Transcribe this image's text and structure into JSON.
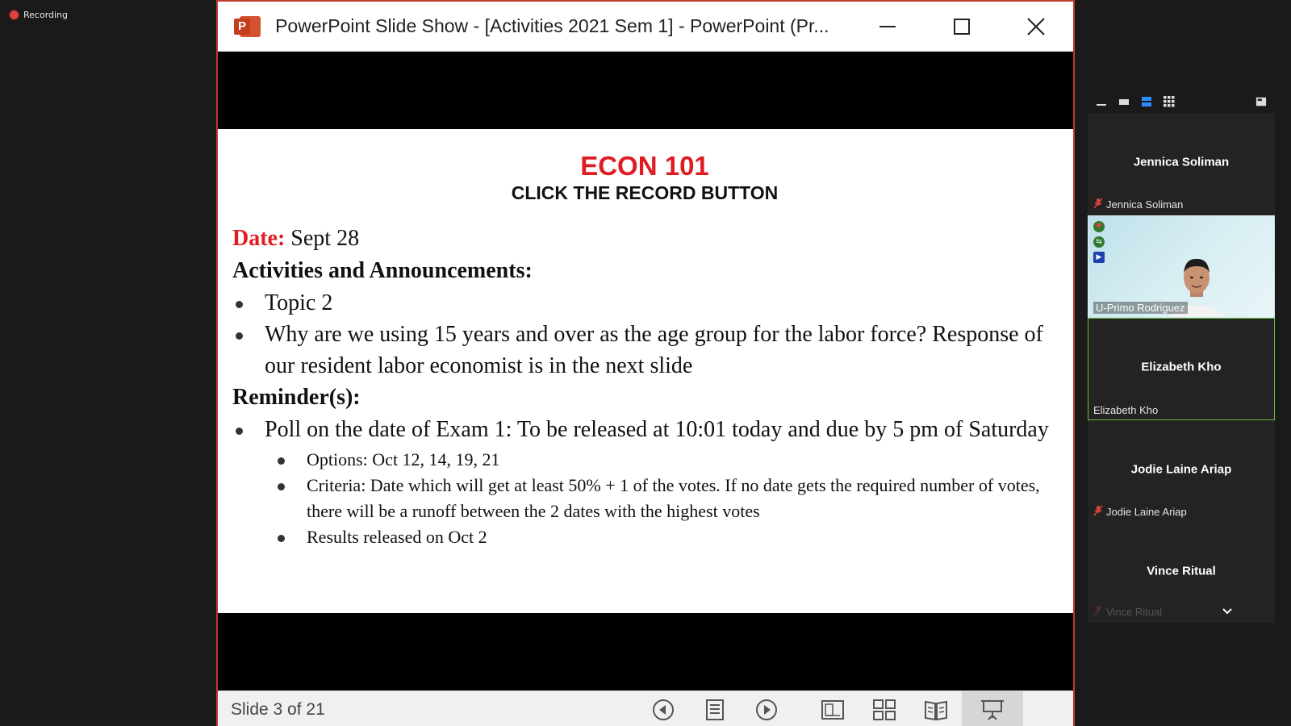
{
  "recording": {
    "label": "Recording"
  },
  "window": {
    "title": "PowerPoint Slide Show - [Activities 2021 Sem 1] - PowerPoint (Pr...",
    "app_icon": "powerpoint-icon",
    "controls": [
      "minimize-icon",
      "maximize-icon",
      "close-icon"
    ]
  },
  "slide": {
    "title": "ECON 101",
    "subtitle": "CLICK THE RECORD BUTTON",
    "date_label": "Date:",
    "date_value": "Sept 28",
    "activities_heading": "Activities and Announcements:",
    "activities": [
      "Topic 2",
      "Why are we using 15 years and over as the age group for the labor force? Response of our resident labor economist is in the next slide"
    ],
    "reminders_heading": "Reminder(s):",
    "reminders": [
      "Poll on the date of Exam 1: To be released at 10:01 today and due by 5 pm of Saturday"
    ],
    "sub_reminders": [
      "Options: Oct 12, 14, 19, 21",
      "Criteria: Date which will get at least 50% + 1 of the votes. If no date gets the required number of votes, there will be a runoff between the 2 dates with the highest votes",
      "Results released on Oct 2"
    ]
  },
  "statusbar": {
    "counter": "Slide 3 of 21",
    "icons": [
      "previous-icon",
      "notes-icon",
      "next-icon",
      "normal-view-icon",
      "slide-sorter-icon",
      "reading-view-icon",
      "slideshow-icon"
    ]
  },
  "participants": [
    {
      "name": "Jennica Soliman",
      "label": "Jennica Soliman",
      "muted": true
    },
    {
      "name": "U-Primo Rodriguez",
      "label": "U-Primo Rodriguez",
      "video": true
    },
    {
      "name": "Elizabeth Kho",
      "label": "Elizabeth Kho",
      "speaking": true
    },
    {
      "name": "Jodie Laine Ariap",
      "label": "Jodie Laine Ariap",
      "muted": true
    },
    {
      "name": "Vince Ritual",
      "label": "Vince Ritual",
      "muted": true
    }
  ],
  "colors": {
    "accent_red": "#e01b24",
    "window_border": "#c0392b",
    "speaking_border": "#6cbf3f"
  }
}
